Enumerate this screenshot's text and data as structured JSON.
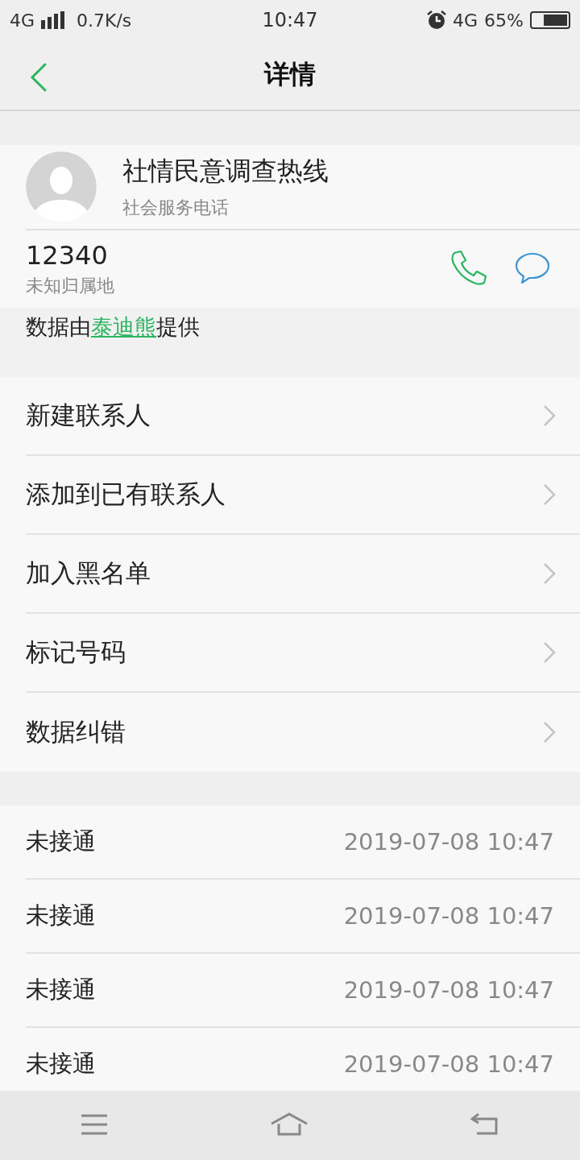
{
  "status_bar": {
    "network": "4G",
    "speed": "0.7K/s",
    "time": "10:47",
    "network_right": "4G",
    "battery": "65%"
  },
  "header": {
    "title": "详情"
  },
  "contact": {
    "name": "社情民意调查热线",
    "category": "社会服务电话",
    "number": "12340",
    "location": "未知归属地"
  },
  "source": {
    "prefix": "数据由",
    "link": "泰迪熊",
    "suffix": "提供"
  },
  "menu": [
    "新建联系人",
    "添加到已有联系人",
    "加入黑名单",
    "标记号码",
    "数据纠错"
  ],
  "calls": [
    {
      "status": "未接通",
      "time": "2019-07-08 10:47"
    },
    {
      "status": "未接通",
      "time": "2019-07-08 10:47"
    },
    {
      "status": "未接通",
      "time": "2019-07-08 10:47"
    },
    {
      "status": "未接通",
      "time": "2019-07-08 10:47"
    }
  ]
}
